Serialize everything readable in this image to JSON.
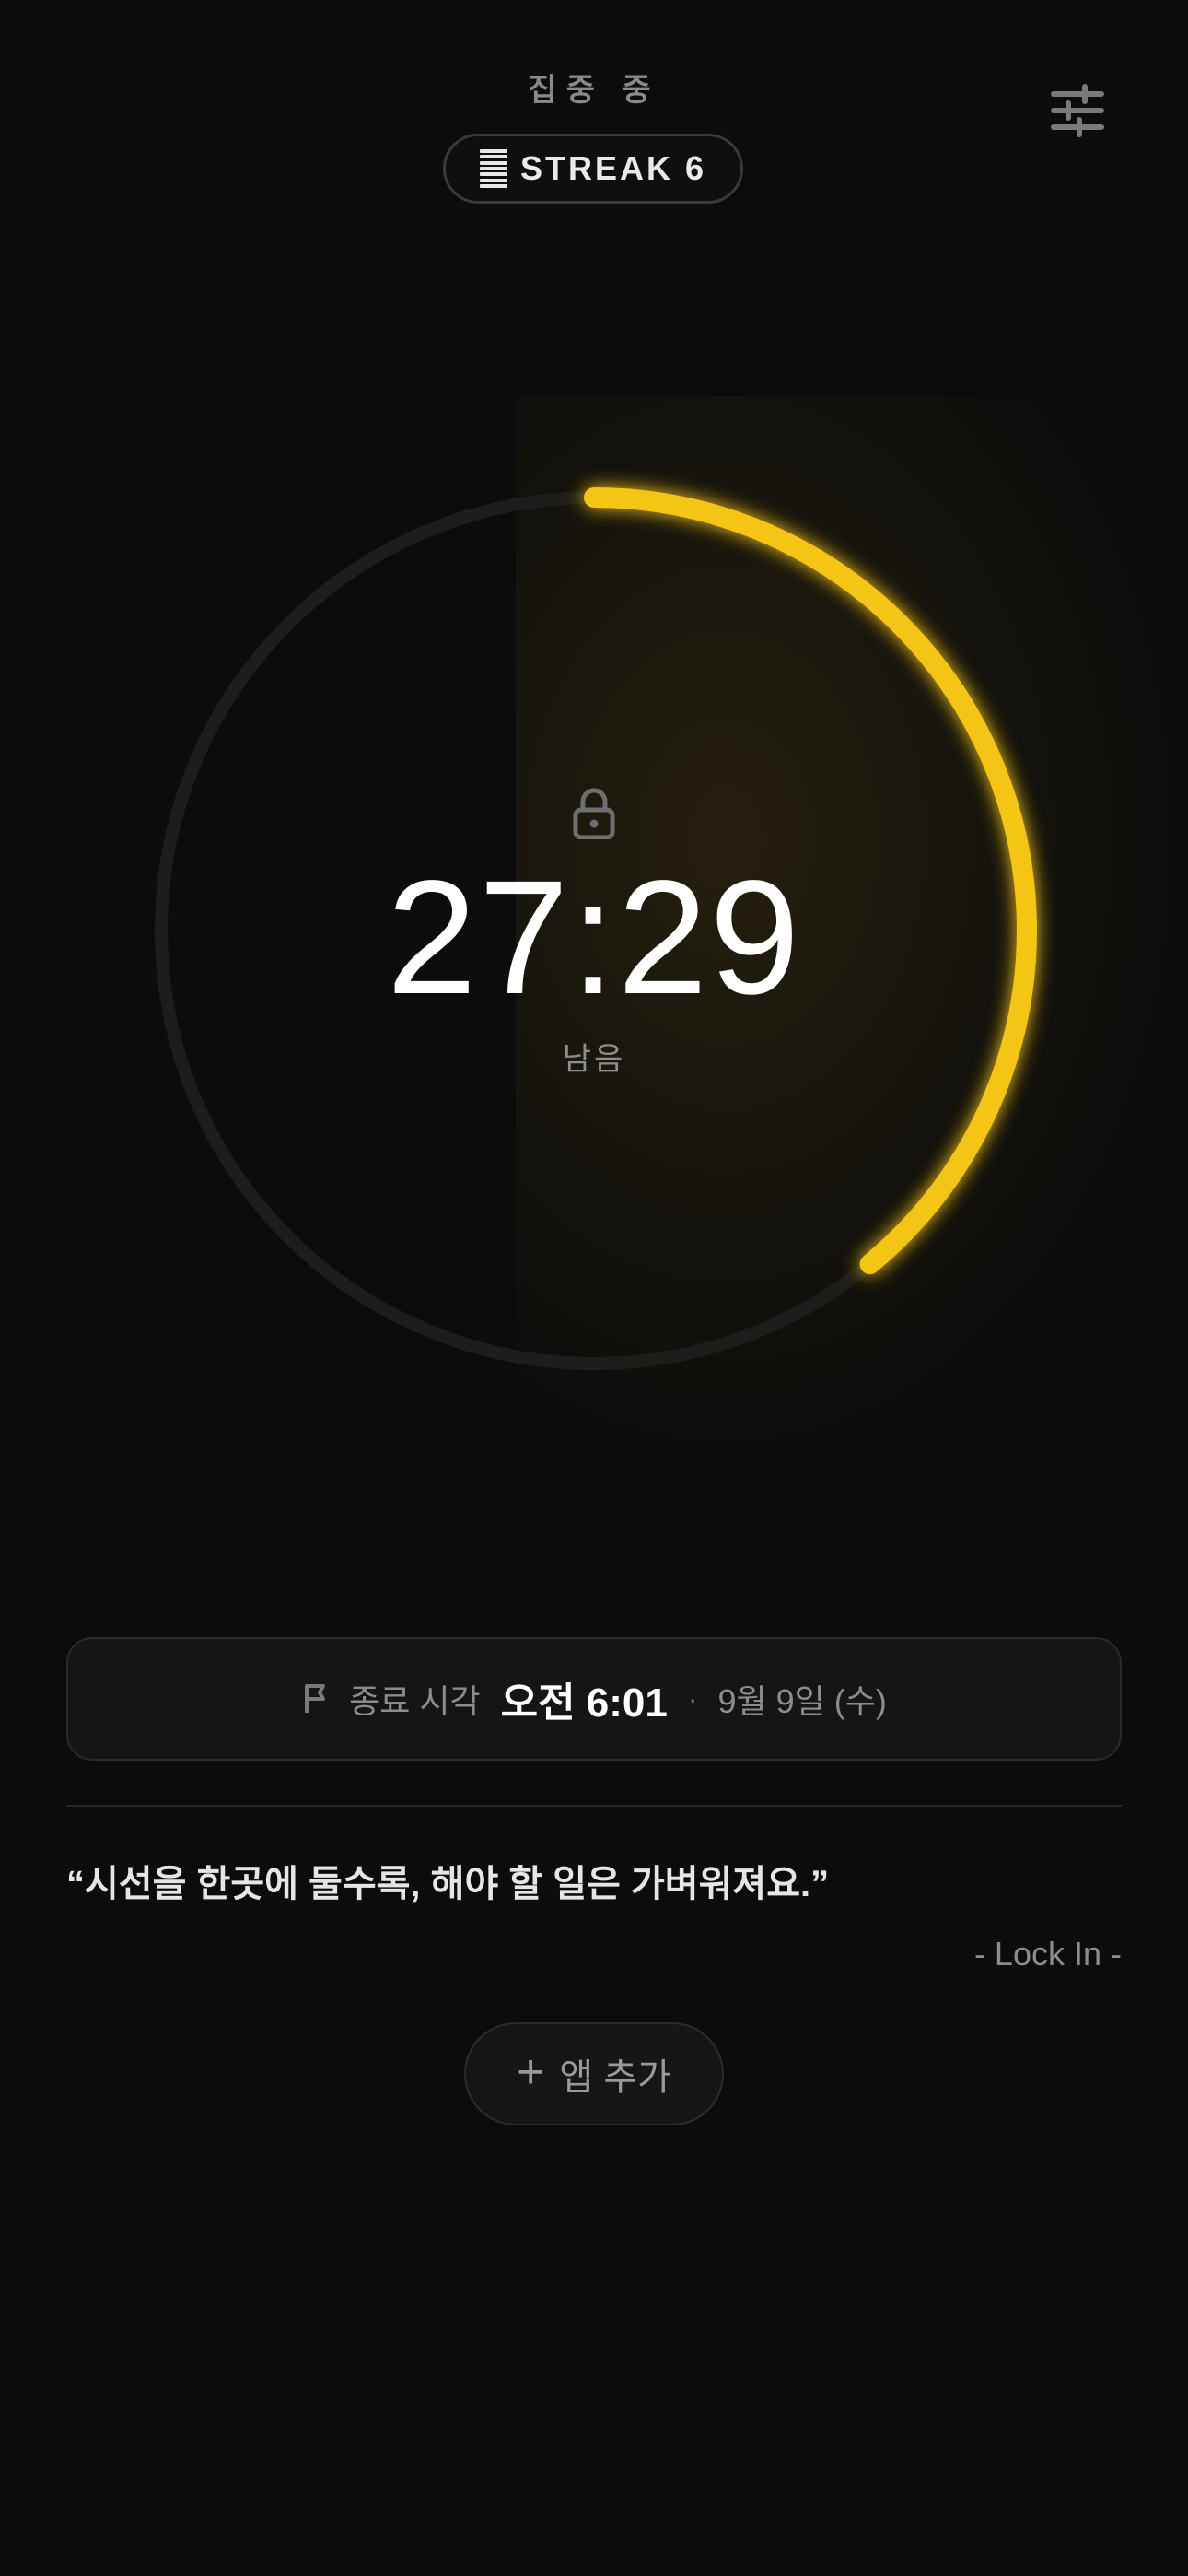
{
  "header": {
    "status_title": "집중 중",
    "streak_label": "STREAK 6",
    "settings_icon": "sliders-icon"
  },
  "timer": {
    "time_remaining": "27:29",
    "remaining_label": "남음",
    "progress_fraction": 0.39,
    "accent_color": "#F5C518",
    "track_color": "#1f1d1b",
    "lock_icon": "lock-icon"
  },
  "end_card": {
    "flag_icon": "flag-icon",
    "label": "종료 시각",
    "time": "오전 6:01",
    "separator": "·",
    "date": "9월 9일 (수)"
  },
  "quote": {
    "text": "“시선을 한곳에 둘수록, 해야 할 일은 가벼워져요.”",
    "author": "- Lock In -"
  },
  "add_app": {
    "icon": "plus-icon",
    "label": "앱 추가"
  }
}
